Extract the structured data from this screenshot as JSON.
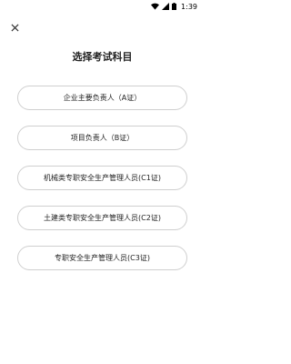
{
  "status_bar": {
    "time": "1:39",
    "icons": [
      "wifi-icon",
      "signal-icon",
      "battery-icon"
    ]
  },
  "header": {
    "close_icon": "close-icon",
    "title": "选择考试科目"
  },
  "subjects": [
    {
      "label": "企业主要负责人（A证）"
    },
    {
      "label": "项目负责人（B证）"
    },
    {
      "label": "机械类专职安全生产管理人员(C1证)"
    },
    {
      "label": "土建类专职安全生产管理人员(C2证)"
    },
    {
      "label": "专职安全生产管理人员(C3证)"
    }
  ]
}
